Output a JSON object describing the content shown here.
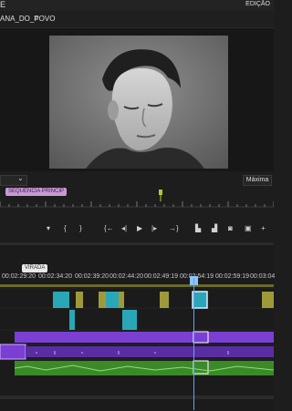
{
  "app": {
    "edge_label": "E",
    "workspace_label": "EDIÇÃO"
  },
  "panel": {
    "title": "ANA_DO_POVO",
    "menu_icon": "hamburger-icon"
  },
  "monitor": {
    "zoom_value": "Máxima",
    "timecode_dropdown": ""
  },
  "mini_ruler": {
    "sequence_marker": "SEQUÊNCIA PRINCIP"
  },
  "transport_icons": [
    "marker-icon",
    "in-point-icon",
    "out-point-icon",
    "go-to-in-icon",
    "step-back-icon",
    "play-icon",
    "step-forward-icon",
    "go-to-out-icon",
    "lift-icon",
    "extract-icon",
    "export-frame-icon",
    "button-editor-icon",
    "add-icon"
  ],
  "timeline": {
    "marker_label": "VIRADA",
    "ruler_timecodes": [
      "00:02:29:20",
      "00:02:34:20",
      "00:02:39:20",
      "00:02:44:20",
      "00:02:49:19",
      "00:02:54:19",
      "00:02:59:19",
      "00:03:04"
    ]
  },
  "colors": {
    "bg": "#1d1d1d",
    "video_clip": "#2aa7b6",
    "video_clip_alt": "#9e9a3a",
    "audio_purple": "#7b3fd3",
    "audio_green": "#3b8a2a",
    "playhead": "#57a6ff",
    "marker_pink": "#c79ad6"
  }
}
